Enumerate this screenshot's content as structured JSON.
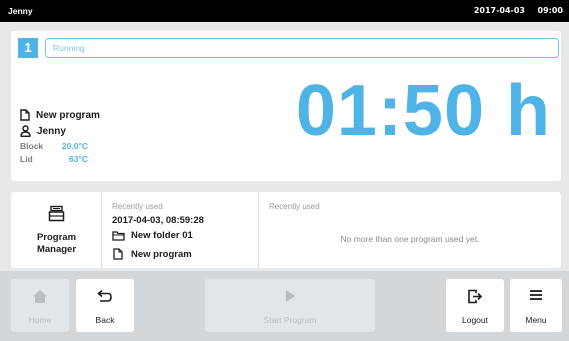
{
  "status_bar": {
    "user": "Jenny",
    "date": "2017-04-03",
    "time": "09:00"
  },
  "run": {
    "block_number": "1",
    "status": "Running",
    "program_name": "New program",
    "user": "Jenny",
    "block_label": "Block",
    "block_temp": "20.0°C",
    "lid_label": "Lid",
    "lid_temp": "63°C",
    "remaining_time": "01:50 h"
  },
  "program_manager": {
    "label_line1": "Program",
    "label_line2": "Manager"
  },
  "recent_left": {
    "header": "Recently used",
    "timestamp": "2017-04-03, 08:59:28",
    "folder": "New folder 01",
    "program": "New program"
  },
  "recent_right": {
    "header": "Recently used",
    "empty_message": "No more than one program used yet."
  },
  "nav": {
    "home": "Home",
    "back": "Back",
    "start_program": "Start Program",
    "logout": "Logout",
    "menu": "Menu"
  },
  "colors": {
    "accent": "#4fb4e5",
    "status_border": "#6cc2ea",
    "disabled": "#b9bdc1"
  }
}
